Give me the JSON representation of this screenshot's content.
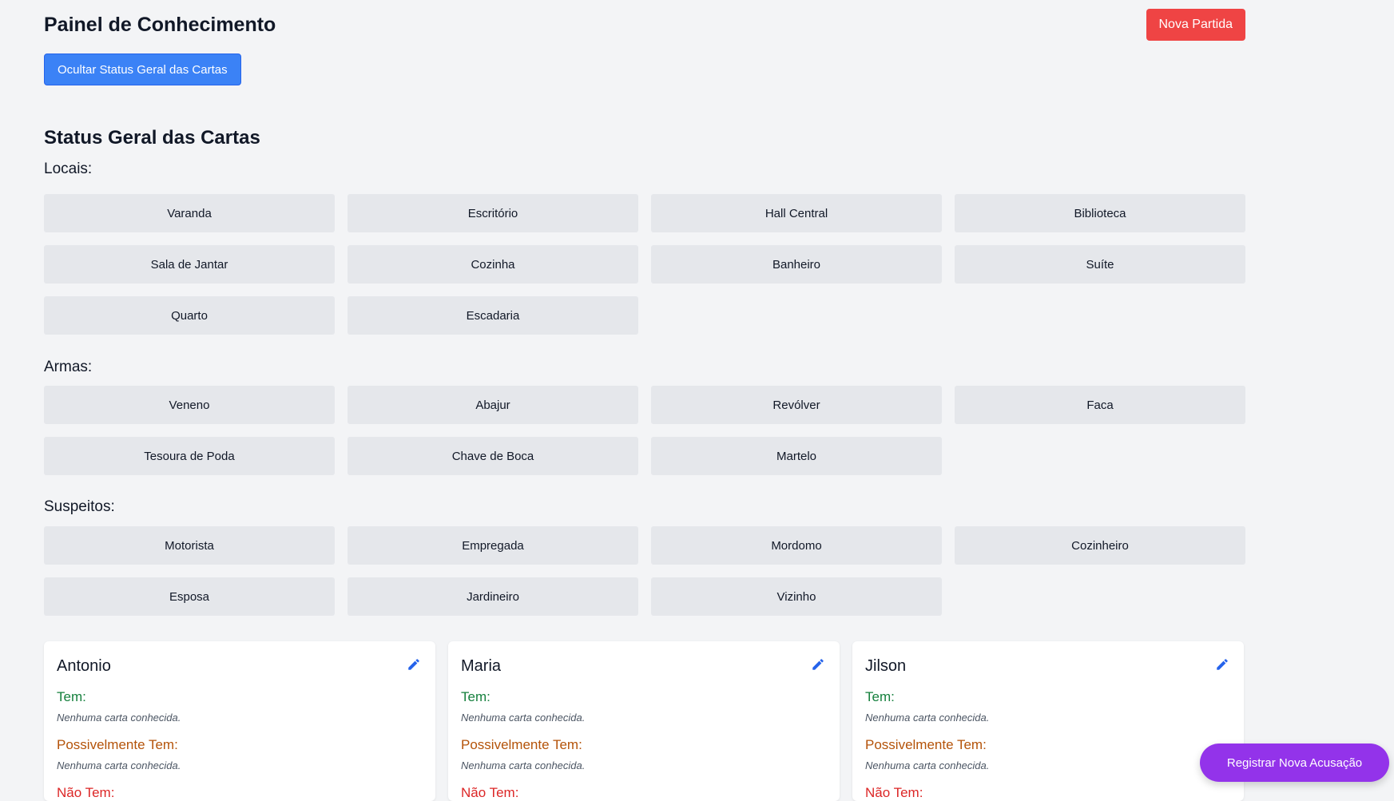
{
  "header": {
    "title": "Painel de Conhecimento",
    "new_game_label": "Nova Partida",
    "toggle_status_label": "Ocultar Status Geral das Cartas"
  },
  "status": {
    "title": "Status Geral das Cartas",
    "locais_label": "Locais:",
    "locais": [
      "Varanda",
      "Escritório",
      "Hall Central",
      "Biblioteca",
      "Sala de Jantar",
      "Cozinha",
      "Banheiro",
      "Suíte",
      "Quarto",
      "Escadaria"
    ],
    "armas_label": "Armas:",
    "armas": [
      "Veneno",
      "Abajur",
      "Revólver",
      "Faca",
      "Tesoura de Poda",
      "Chave de Boca",
      "Martelo"
    ],
    "suspeitos_label": "Suspeitos:",
    "suspeitos": [
      "Motorista",
      "Empregada",
      "Mordomo",
      "Cozinheiro",
      "Esposa",
      "Jardineiro",
      "Vizinho"
    ]
  },
  "players": [
    {
      "name": "Antonio",
      "tem_label": "Tem:",
      "tem_empty": "Nenhuma carta conhecida.",
      "poss_label": "Possivelmente Tem:",
      "poss_empty": "Nenhuma carta conhecida.",
      "nao_label": "Não Tem:",
      "edit_icon": "pencil-icon"
    },
    {
      "name": "Maria",
      "tem_label": "Tem:",
      "tem_empty": "Nenhuma carta conhecida.",
      "poss_label": "Possivelmente Tem:",
      "poss_empty": "Nenhuma carta conhecida.",
      "nao_label": "Não Tem:",
      "edit_icon": "pencil-icon"
    },
    {
      "name": "Jilson",
      "tem_label": "Tem:",
      "tem_empty": "Nenhuma carta conhecida.",
      "poss_label": "Possivelmente Tem:",
      "poss_empty": "Nenhuma carta conhecida.",
      "nao_label": "Não Tem:",
      "edit_icon": "pencil-icon"
    }
  ],
  "accuse_label": "Registrar Nova Acusação",
  "colors": {
    "background": "#f3f4f6",
    "new_game": "#ef4444",
    "toggle": "#3b82f6",
    "chip": "#e5e7eb",
    "tem": "#15803d",
    "possivelmente": "#b45309",
    "nao_tem": "#dc2626",
    "accuse": "#9333ea",
    "edit_icon": "#2563eb"
  }
}
